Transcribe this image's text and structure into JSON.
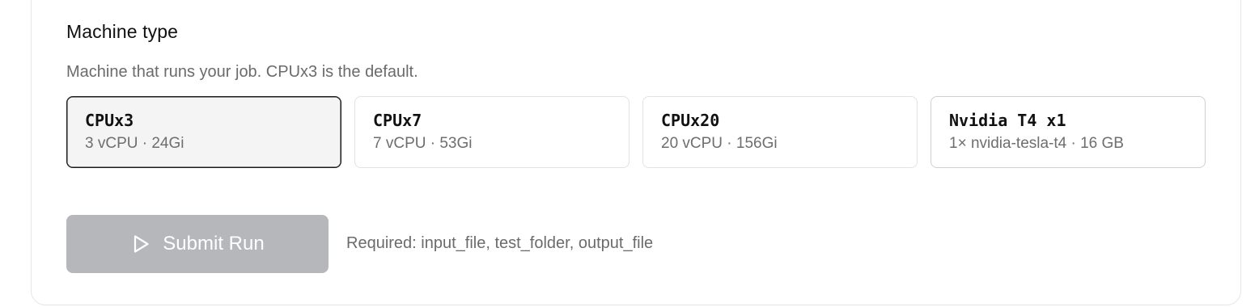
{
  "machine_type": {
    "title": "Machine type",
    "description": "Machine that runs your job. CPUx3 is the default.",
    "selected": "CPUx3",
    "options": [
      {
        "name": "CPUx3",
        "spec": "3 vCPU · 24Gi"
      },
      {
        "name": "CPUx7",
        "spec": "7 vCPU · 53Gi"
      },
      {
        "name": "CPUx20",
        "spec": "20 vCPU · 156Gi"
      },
      {
        "name": "Nvidia T4 x1",
        "spec": "1× nvidia-tesla-t4 · 16 GB"
      }
    ]
  },
  "submit": {
    "label": "Submit Run",
    "icon": "play-icon",
    "disabled": true
  },
  "required_note": "Required: input_file, test_folder, output_file",
  "colors": {
    "button_disabled_bg": "#b6b7bb",
    "selected_bg": "#f4f4f4",
    "selected_border": "#1a1a1a",
    "muted_text": "#6b6b6b"
  }
}
